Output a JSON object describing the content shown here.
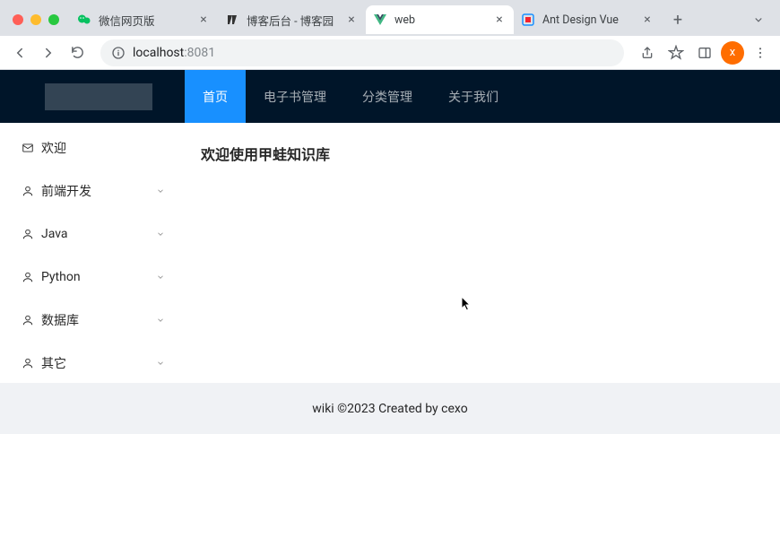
{
  "browser": {
    "tabs": [
      {
        "title": "微信网页版",
        "favicon_color": "#07c160"
      },
      {
        "title": "博客后台 - 博客园",
        "favicon_color": "#333333"
      },
      {
        "title": "web",
        "favicon_color": "#41b883",
        "active": true
      },
      {
        "title": "Ant Design Vue",
        "favicon_color": "#1890ff"
      }
    ],
    "address": {
      "host": "localhost",
      "port": ":8081"
    },
    "avatar_letter": "x"
  },
  "header": {
    "nav": [
      {
        "label": "首页",
        "active": true
      },
      {
        "label": "电子书管理"
      },
      {
        "label": "分类管理"
      },
      {
        "label": "关于我们"
      }
    ]
  },
  "sidebar": {
    "items": [
      {
        "label": "欢迎",
        "icon": "mail",
        "expandable": false
      },
      {
        "label": "前端开发",
        "icon": "user",
        "expandable": true
      },
      {
        "label": "Java",
        "icon": "user",
        "expandable": true
      },
      {
        "label": "Python",
        "icon": "user",
        "expandable": true
      },
      {
        "label": "数据库",
        "icon": "user",
        "expandable": true
      },
      {
        "label": "其它",
        "icon": "user",
        "expandable": true
      }
    ]
  },
  "main": {
    "title": "欢迎使用甲蛙知识库"
  },
  "footer": {
    "text": "wiki ©2023 Created by cexo"
  }
}
